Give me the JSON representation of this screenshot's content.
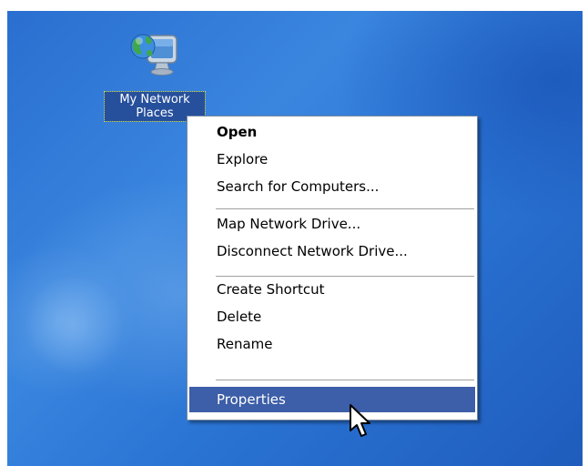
{
  "desktop": {
    "icon": {
      "name": "network-places-icon",
      "label": "My Network Places"
    }
  },
  "context_menu": {
    "groups": [
      [
        {
          "label": "Open",
          "bold": true
        },
        {
          "label": "Explore"
        },
        {
          "label": "Search for Computers..."
        }
      ],
      [
        {
          "label": "Map Network Drive..."
        },
        {
          "label": "Disconnect Network Drive..."
        }
      ],
      [
        {
          "label": "Create Shortcut"
        },
        {
          "label": "Delete"
        },
        {
          "label": "Rename"
        }
      ],
      [
        {
          "label": "Properties",
          "selected": true
        }
      ]
    ]
  },
  "colors": {
    "desktop_blue": "#2a74d4",
    "selection_blue": "#3d5ea8",
    "menu_border": "#7a8aa0"
  }
}
